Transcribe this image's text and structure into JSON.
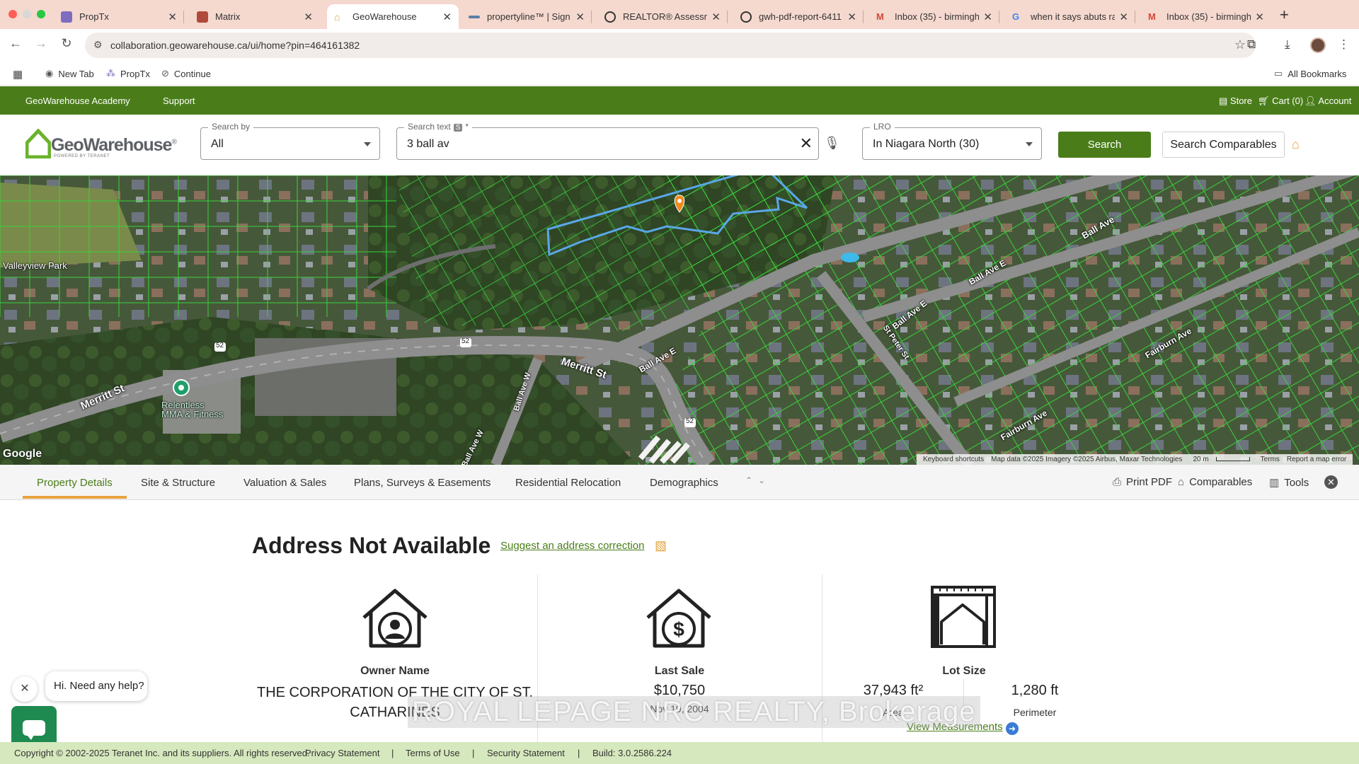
{
  "browser": {
    "tabs": [
      {
        "title": "PropTx",
        "favicon_color": "#7d6cc0"
      },
      {
        "title": "Matrix",
        "favicon_color": "#b04a3a"
      },
      {
        "title": "GeoWarehouse",
        "favicon_color": "#e2a23a"
      },
      {
        "title": "propertyline™ | Sign I",
        "favicon_color": "#5b7fa8"
      },
      {
        "title": "REALTOR® Assessme",
        "favicon_color": "#333333"
      },
      {
        "title": "gwh-pdf-report-6411",
        "favicon_color": "#333333"
      },
      {
        "title": "Inbox (35) - birmingh",
        "favicon_color": "#d44638"
      },
      {
        "title": "when it says abuts ra",
        "favicon_color": "#4285f4"
      },
      {
        "title": "Inbox (35) - birmingh",
        "favicon_color": "#d44638"
      }
    ],
    "tab_close": "✕",
    "new_tab": "+",
    "url": "collaboration.geowarehouse.ca/ui/home?pin=464161382",
    "bookmarks": [
      {
        "label": "New Tab",
        "icon": "globe-icon"
      },
      {
        "label": "PropTx",
        "icon": "proptx-icon"
      },
      {
        "label": "Continue",
        "icon": "continue-icon"
      }
    ],
    "all_bookmarks": "All Bookmarks"
  },
  "topnav": {
    "academy": "GeoWarehouse Academy",
    "support": "Support",
    "store": "Store",
    "cart": "Cart (0)",
    "account": "Account"
  },
  "search": {
    "logo_word": "GeoWarehouse",
    "logo_reg": "®",
    "logo_tag": "POWERED BY TERANET",
    "search_by_label": "Search by",
    "search_by_value": "All",
    "search_text_label": "Search text",
    "search_text_badge": "S",
    "search_text_required": "*",
    "search_text_value": "3 ball av",
    "lro_label": "LRO",
    "lro_value": "In Niagara North (30)",
    "search_button": "Search",
    "comparables_button": "Search Comparables"
  },
  "map": {
    "labels": {
      "valleyview": "Valleyview Park",
      "merritt_west": "Merritt St",
      "merritt_east": "Merritt St",
      "ball_ave_e1": "Ball Ave E",
      "ball_ave_e2": "Ball Ave E",
      "ball_ave_e3": "Ball Ave E",
      "ball_ave": "Ball Ave",
      "ball_ave_w1": "Ball Ave W",
      "ball_ave_w2": "Ball Ave W",
      "st_peter": "St Peter St",
      "fairburn": "Fairburn Ave",
      "fairburn2": "Fairburn Ave",
      "relentless": "Relentless\nMMA & Fitness",
      "hwy52a": "52",
      "hwy52b": "52",
      "hwy52c": "52"
    },
    "google": "Google",
    "attribution": {
      "shortcuts": "Keyboard shortcuts",
      "data": "Map data ©2025 Imagery ©2025 Airbus, Maxar Technologies",
      "scale": "20 m",
      "terms": "Terms",
      "report": "Report a map error"
    },
    "colors": {
      "parcel": "#39d23a",
      "selected": "#5aa7e8",
      "pin": "#f08a1e"
    }
  },
  "detail_tabs": [
    {
      "label": "Property Details",
      "active": true
    },
    {
      "label": "Site & Structure",
      "active": false
    },
    {
      "label": "Valuation & Sales",
      "active": false
    },
    {
      "label": "Plans, Surveys & Easements",
      "active": false
    },
    {
      "label": "Residential Relocation",
      "active": false
    },
    {
      "label": "Demographics",
      "active": false
    }
  ],
  "tools": {
    "print": "Print PDF",
    "comparables": "Comparables",
    "tools": "Tools"
  },
  "property": {
    "title": "Address Not Available",
    "suggest": "Suggest an address correction",
    "owner": {
      "heading": "Owner Name",
      "value": "THE CORPORATION OF THE CITY OF ST. CATHARINES"
    },
    "sale": {
      "heading": "Last Sale",
      "price": "$10,750",
      "date": "Nov 19, 2004"
    },
    "lot": {
      "heading": "Lot Size",
      "area": "37,943 ft²",
      "area_label": "Area",
      "perimeter": "1,280 ft",
      "perimeter_label": "Perimeter",
      "view": "View Measurements"
    }
  },
  "watermark": "ROYAL LEPAGE NRC REALTY, Brokerage",
  "chat": {
    "prompt": "Hi. Need any help?",
    "close": "✕"
  },
  "footer": {
    "copyright": "Copyright © 2002-2025 Teranet Inc. and its suppliers. All rights reserved.",
    "privacy": "Privacy Statement",
    "terms": "Terms of Use",
    "security": "Security Statement",
    "build": "Build: 3.0.2586.224",
    "separator": "|"
  }
}
